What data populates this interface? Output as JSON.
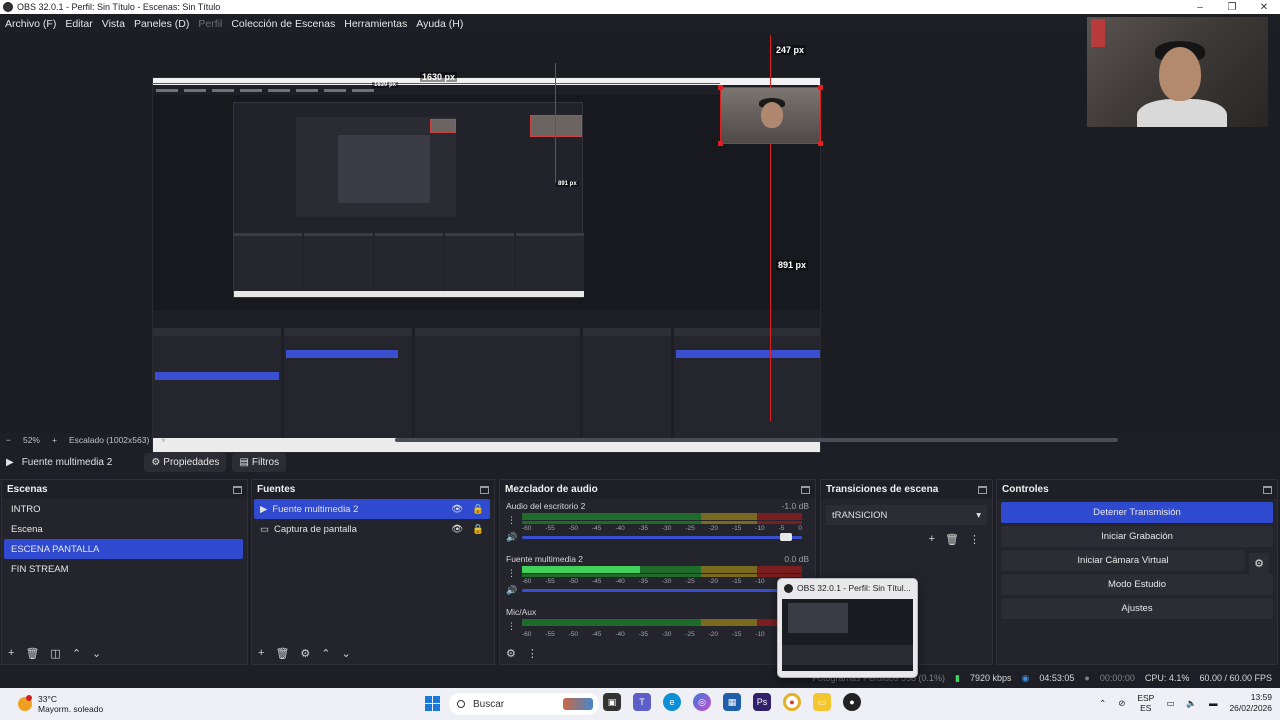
{
  "window": {
    "title": "OBS 32.0.1 - Perfil: Sin Título - Escenas: Sin Título",
    "controls": [
      "–",
      "❐",
      "✕"
    ]
  },
  "menu": {
    "items": [
      {
        "label": "Archivo (F)",
        "enabled": true
      },
      {
        "label": "Editar",
        "enabled": true
      },
      {
        "label": "Vista",
        "enabled": true
      },
      {
        "label": "Paneles (D)",
        "enabled": true
      },
      {
        "label": "Perfil",
        "enabled": false
      },
      {
        "label": "Colección de Escenas",
        "enabled": true
      },
      {
        "label": "Herramientas",
        "enabled": true
      },
      {
        "label": "Ayuda (H)",
        "enabled": true
      }
    ]
  },
  "preview": {
    "guide_labels": {
      "width_top": "1630 px",
      "mini_width": "1630 px",
      "mini_height": "891 px",
      "height": "891 px",
      "cam_label": "247 px"
    }
  },
  "zoom_bar": {
    "minus": "−",
    "zoom": "52%",
    "plus": "+",
    "scale": "Escalado (1002x563)"
  },
  "source_toolbar": {
    "source_name": "Fuente multimedia 2",
    "properties": "Propiedades",
    "filters": "Filtros"
  },
  "scenes": {
    "title": "Escenas",
    "items": [
      "INTRO",
      "Escena",
      "ESCENA PANTALLA",
      "FIN STREAM"
    ],
    "active": "ESCENA PANTALLA"
  },
  "sources": {
    "title": "Fuentes",
    "items": [
      {
        "name": "Fuente multimedia 2",
        "icon": "play-icon",
        "active": true
      },
      {
        "name": "Captura de pantalla",
        "icon": "monitor-icon",
        "active": false
      }
    ]
  },
  "mixer": {
    "title": "Mezclador de audio",
    "channels": [
      {
        "name": "Audio del escritorio 2",
        "db": "-1.0 dB",
        "level": 0
      },
      {
        "name": "Fuente multimedia 2",
        "db": "0.0 dB",
        "level": 0.42
      },
      {
        "name": "Mic/Aux",
        "db": "",
        "level": 0
      }
    ],
    "ticks": [
      "-60",
      "-55",
      "-50",
      "-45",
      "-40",
      "-35",
      "-30",
      "-25",
      "-20",
      "-15",
      "-10",
      "-5",
      "0"
    ]
  },
  "transitions": {
    "title": "Transiciones de escena",
    "selected": "tRANSICION"
  },
  "controls": {
    "title": "Controles",
    "stop_stream": "Detener Transmisión",
    "start_recording": "Iniciar Grabación",
    "start_virtual_cam": "Iniciar Cámara Virtual",
    "studio_mode": "Modo Estudio",
    "settings": "Ajustes"
  },
  "status": {
    "frames_dropped": "Fotogramas Perdidos 538 (0.1%)",
    "bitrate": "7920 kbps",
    "stream_time": "04:53:05",
    "rec_time": "00:00:00",
    "cpu": "CPU: 4.1%",
    "fps": "60.00 / 60.00 FPS"
  },
  "popup": {
    "title": "OBS 32.0.1 - Perfil: Sin Títul..."
  },
  "taskbar": {
    "temperature": "33°C",
    "weather": "Mayorm. soleado",
    "search": "Buscar",
    "lang_top": "ESP",
    "lang_bottom": "ES",
    "time": "13:59",
    "date": "26/02/2026"
  },
  "colors": {
    "accent": "#2f49cf",
    "guide": "#e02020",
    "meter_green": "#3fd15a"
  }
}
